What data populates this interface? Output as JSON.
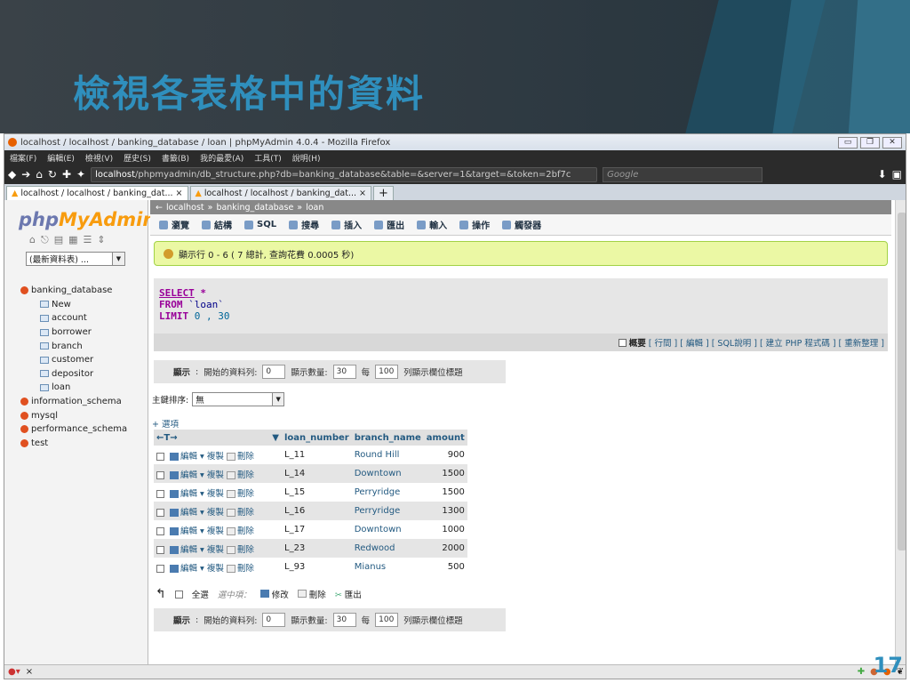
{
  "slide": {
    "title": "檢視各表格中的資料",
    "page_number": "17"
  },
  "window": {
    "title": "localhost / localhost / banking_database / loan | phpMyAdmin 4.0.4 - Mozilla Firefox"
  },
  "menubar": [
    "檔案(F)",
    "編輯(E)",
    "檢視(V)",
    "歷史(S)",
    "書籤(B)",
    "我的最愛(A)",
    "工具(T)",
    "說明(H)"
  ],
  "address": {
    "host": "localhost",
    "path": "/phpmyadmin/db_structure.php?db=banking_database&table=&server=1&target=&token=2bf7c"
  },
  "search_placeholder": "Google",
  "tabs": [
    "localhost / localhost / banking_dat...",
    "localhost / localhost / banking_dat..."
  ],
  "sidebar": {
    "logo_php": "php",
    "logo_my": "MyAdmin",
    "recent": "(最新資料表) ...",
    "tree": [
      {
        "label": "banking_database",
        "type": "db"
      },
      {
        "label": "New",
        "type": "new"
      },
      {
        "label": "account",
        "type": "table"
      },
      {
        "label": "borrower",
        "type": "table"
      },
      {
        "label": "branch",
        "type": "table"
      },
      {
        "label": "customer",
        "type": "table"
      },
      {
        "label": "depositor",
        "type": "table"
      },
      {
        "label": "loan",
        "type": "table"
      },
      {
        "label": "information_schema",
        "type": "db"
      },
      {
        "label": "mysql",
        "type": "db"
      },
      {
        "label": "performance_schema",
        "type": "db"
      },
      {
        "label": "test",
        "type": "db"
      }
    ]
  },
  "breadcrumb": [
    "localhost",
    "banking_database",
    "loan"
  ],
  "toptabs": [
    "瀏覽",
    "結構",
    "SQL",
    "搜尋",
    "插入",
    "匯出",
    "輸入",
    "操作",
    "觸發器"
  ],
  "message": "顯示行 0 - 6 ( 7 總計, 查詢花費 0.0005 秒)",
  "sql": {
    "select": "SELECT",
    "star": "*",
    "from": "FROM",
    "table": "`loan`",
    "limit": "LIMIT",
    "limit_val": "0 , 30"
  },
  "sql_links": [
    "概要",
    "[ 行間 ]",
    "[ 編輯 ]",
    "[ SQL說明 ]",
    "[ 建立 PHP 程式碼 ]",
    "[ 重新整理 ]"
  ],
  "show": {
    "label": "顯示",
    "start_label": "開始的資料列:",
    "start": "0",
    "count_label": "顯示數量:",
    "count": "30",
    "every": "每",
    "every_val": "100",
    "header_label": "列顯示欄位標題"
  },
  "sort": {
    "label": "主鍵排序:",
    "value": "無"
  },
  "options_label": "+ 選項",
  "table": {
    "nav": "←T→",
    "headers": [
      "loan_number",
      "branch_name",
      "amount"
    ],
    "action_labels": {
      "edit": "編輯",
      "copy": "複製",
      "delete": "刪除"
    },
    "rows": [
      {
        "loan_number": "L_11",
        "branch_name": "Round Hill",
        "amount": "900"
      },
      {
        "loan_number": "L_14",
        "branch_name": "Downtown",
        "amount": "1500"
      },
      {
        "loan_number": "L_15",
        "branch_name": "Perryridge",
        "amount": "1500"
      },
      {
        "loan_number": "L_16",
        "branch_name": "Perryridge",
        "amount": "1300"
      },
      {
        "loan_number": "L_17",
        "branch_name": "Downtown",
        "amount": "1000"
      },
      {
        "loan_number": "L_23",
        "branch_name": "Redwood",
        "amount": "2000"
      },
      {
        "loan_number": "L_93",
        "branch_name": "Mianus",
        "amount": "500"
      }
    ]
  },
  "bottom": {
    "select_all": "全選",
    "selected": "選中項：",
    "modify": "修改",
    "delete": "刪除",
    "export": "匯出"
  }
}
